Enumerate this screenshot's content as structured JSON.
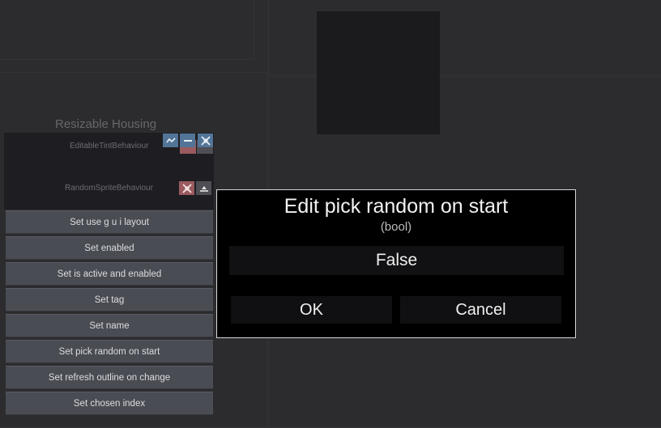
{
  "housing": {
    "title": "Resizable Housing",
    "components": [
      {
        "label": "EditableTintBehaviour"
      },
      {
        "label": "RandomSpriteBehaviour"
      }
    ]
  },
  "icons": {
    "expand_up": "chevron-up-icon",
    "minimize": "minus-icon",
    "close": "close-x-icon",
    "remove": "remove-x-icon",
    "collapse": "triangle-up-icon"
  },
  "colors": {
    "icon_blue": "#527497",
    "icon_red": "#9a5a5e",
    "button_bg": "#4a4c54",
    "dialog_border": "#d6d6d6"
  },
  "menu": {
    "items": [
      "Set use g u i layout",
      "Set enabled",
      "Set is active and enabled",
      "Set tag",
      "Set name",
      "Set pick random on start",
      "Set refresh outline on change",
      "Set chosen index"
    ]
  },
  "dialog": {
    "title": "Edit pick random on start",
    "subtitle": "(bool)",
    "value": "False",
    "ok_label": "OK",
    "cancel_label": "Cancel"
  }
}
